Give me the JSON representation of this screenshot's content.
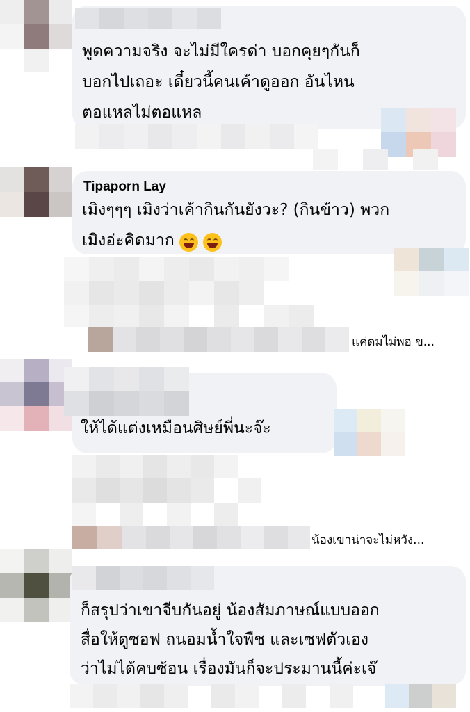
{
  "comments": [
    {
      "author": "",
      "text_lines": [
        "พูดความจริง จะไม่มีใครด่า บอกคุยๆกันก็",
        "บอกไปเถอะ เดี๋ยวนี้คนเค้าดูออก อันไหน",
        "ตอแหลไม่ตอแหล"
      ]
    },
    {
      "author": "Tipaporn Lay",
      "text_lines": [
        "เมิงๆๆๆ เมิงว่าเค้ากินกันยังวะ? (กินข้าว) พวก",
        "เมิงอ่ะคิดมาก"
      ],
      "emojis": [
        "grinning-sweat-emoji",
        "tears-of-joy-emoji"
      ],
      "reply_preview": "แค่ดมไม่พอ ข..."
    },
    {
      "author": "",
      "text_lines": [
        "ให้ได้แต่งเหมือนศิษย์พี่นะจ๊ะ"
      ],
      "reply_preview": "น้องเขาน่าจะไม่หวัง..."
    },
    {
      "author": "",
      "text_lines": [
        "ก็สรุปว่าเขาจีบกันอยู่ น้องสัมภาษณ์แบบออก",
        "สื่อให้ดูซอฟ ถนอมน้ำใจพืช และเซฟตัวเอง",
        "ว่าไม่ได้คบซ้อน เรื่องมันก็จะประมานนี้ค่ะเจ๊"
      ]
    }
  ],
  "colors": {
    "bubble": "#f0f2f5",
    "text": "#050505"
  }
}
